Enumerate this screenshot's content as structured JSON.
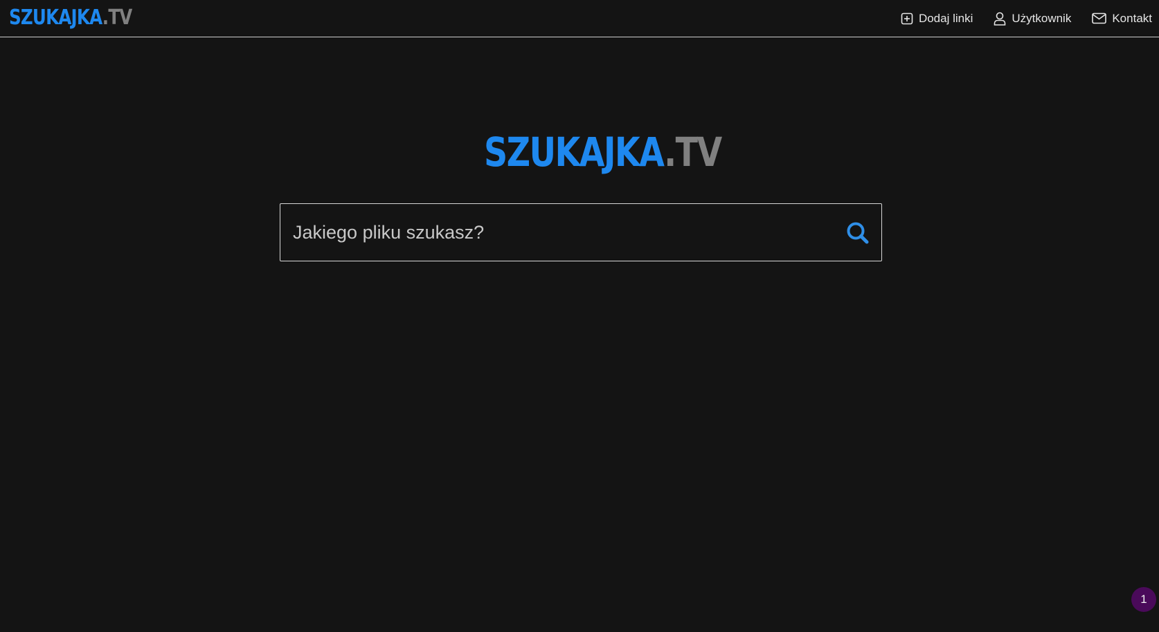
{
  "header": {
    "logo": {
      "brand": "SZUKAJKA",
      "tld": ".TV"
    },
    "nav": [
      {
        "label": "Dodaj linki",
        "icon": "plus-square-icon"
      },
      {
        "label": "Użytkownik",
        "icon": "user-icon"
      },
      {
        "label": "Kontakt",
        "icon": "envelope-icon"
      }
    ]
  },
  "hero": {
    "logo": {
      "brand": "SZUKAJKA",
      "tld": ".TV"
    }
  },
  "search": {
    "placeholder": "Jakiego pliku szukasz?",
    "value": "",
    "icon": "search-icon"
  },
  "badge": {
    "count": "1"
  },
  "colors": {
    "background": "#141414",
    "brand": "#1e88ef",
    "tld": "#808080",
    "badge": "#4a0a5a"
  }
}
